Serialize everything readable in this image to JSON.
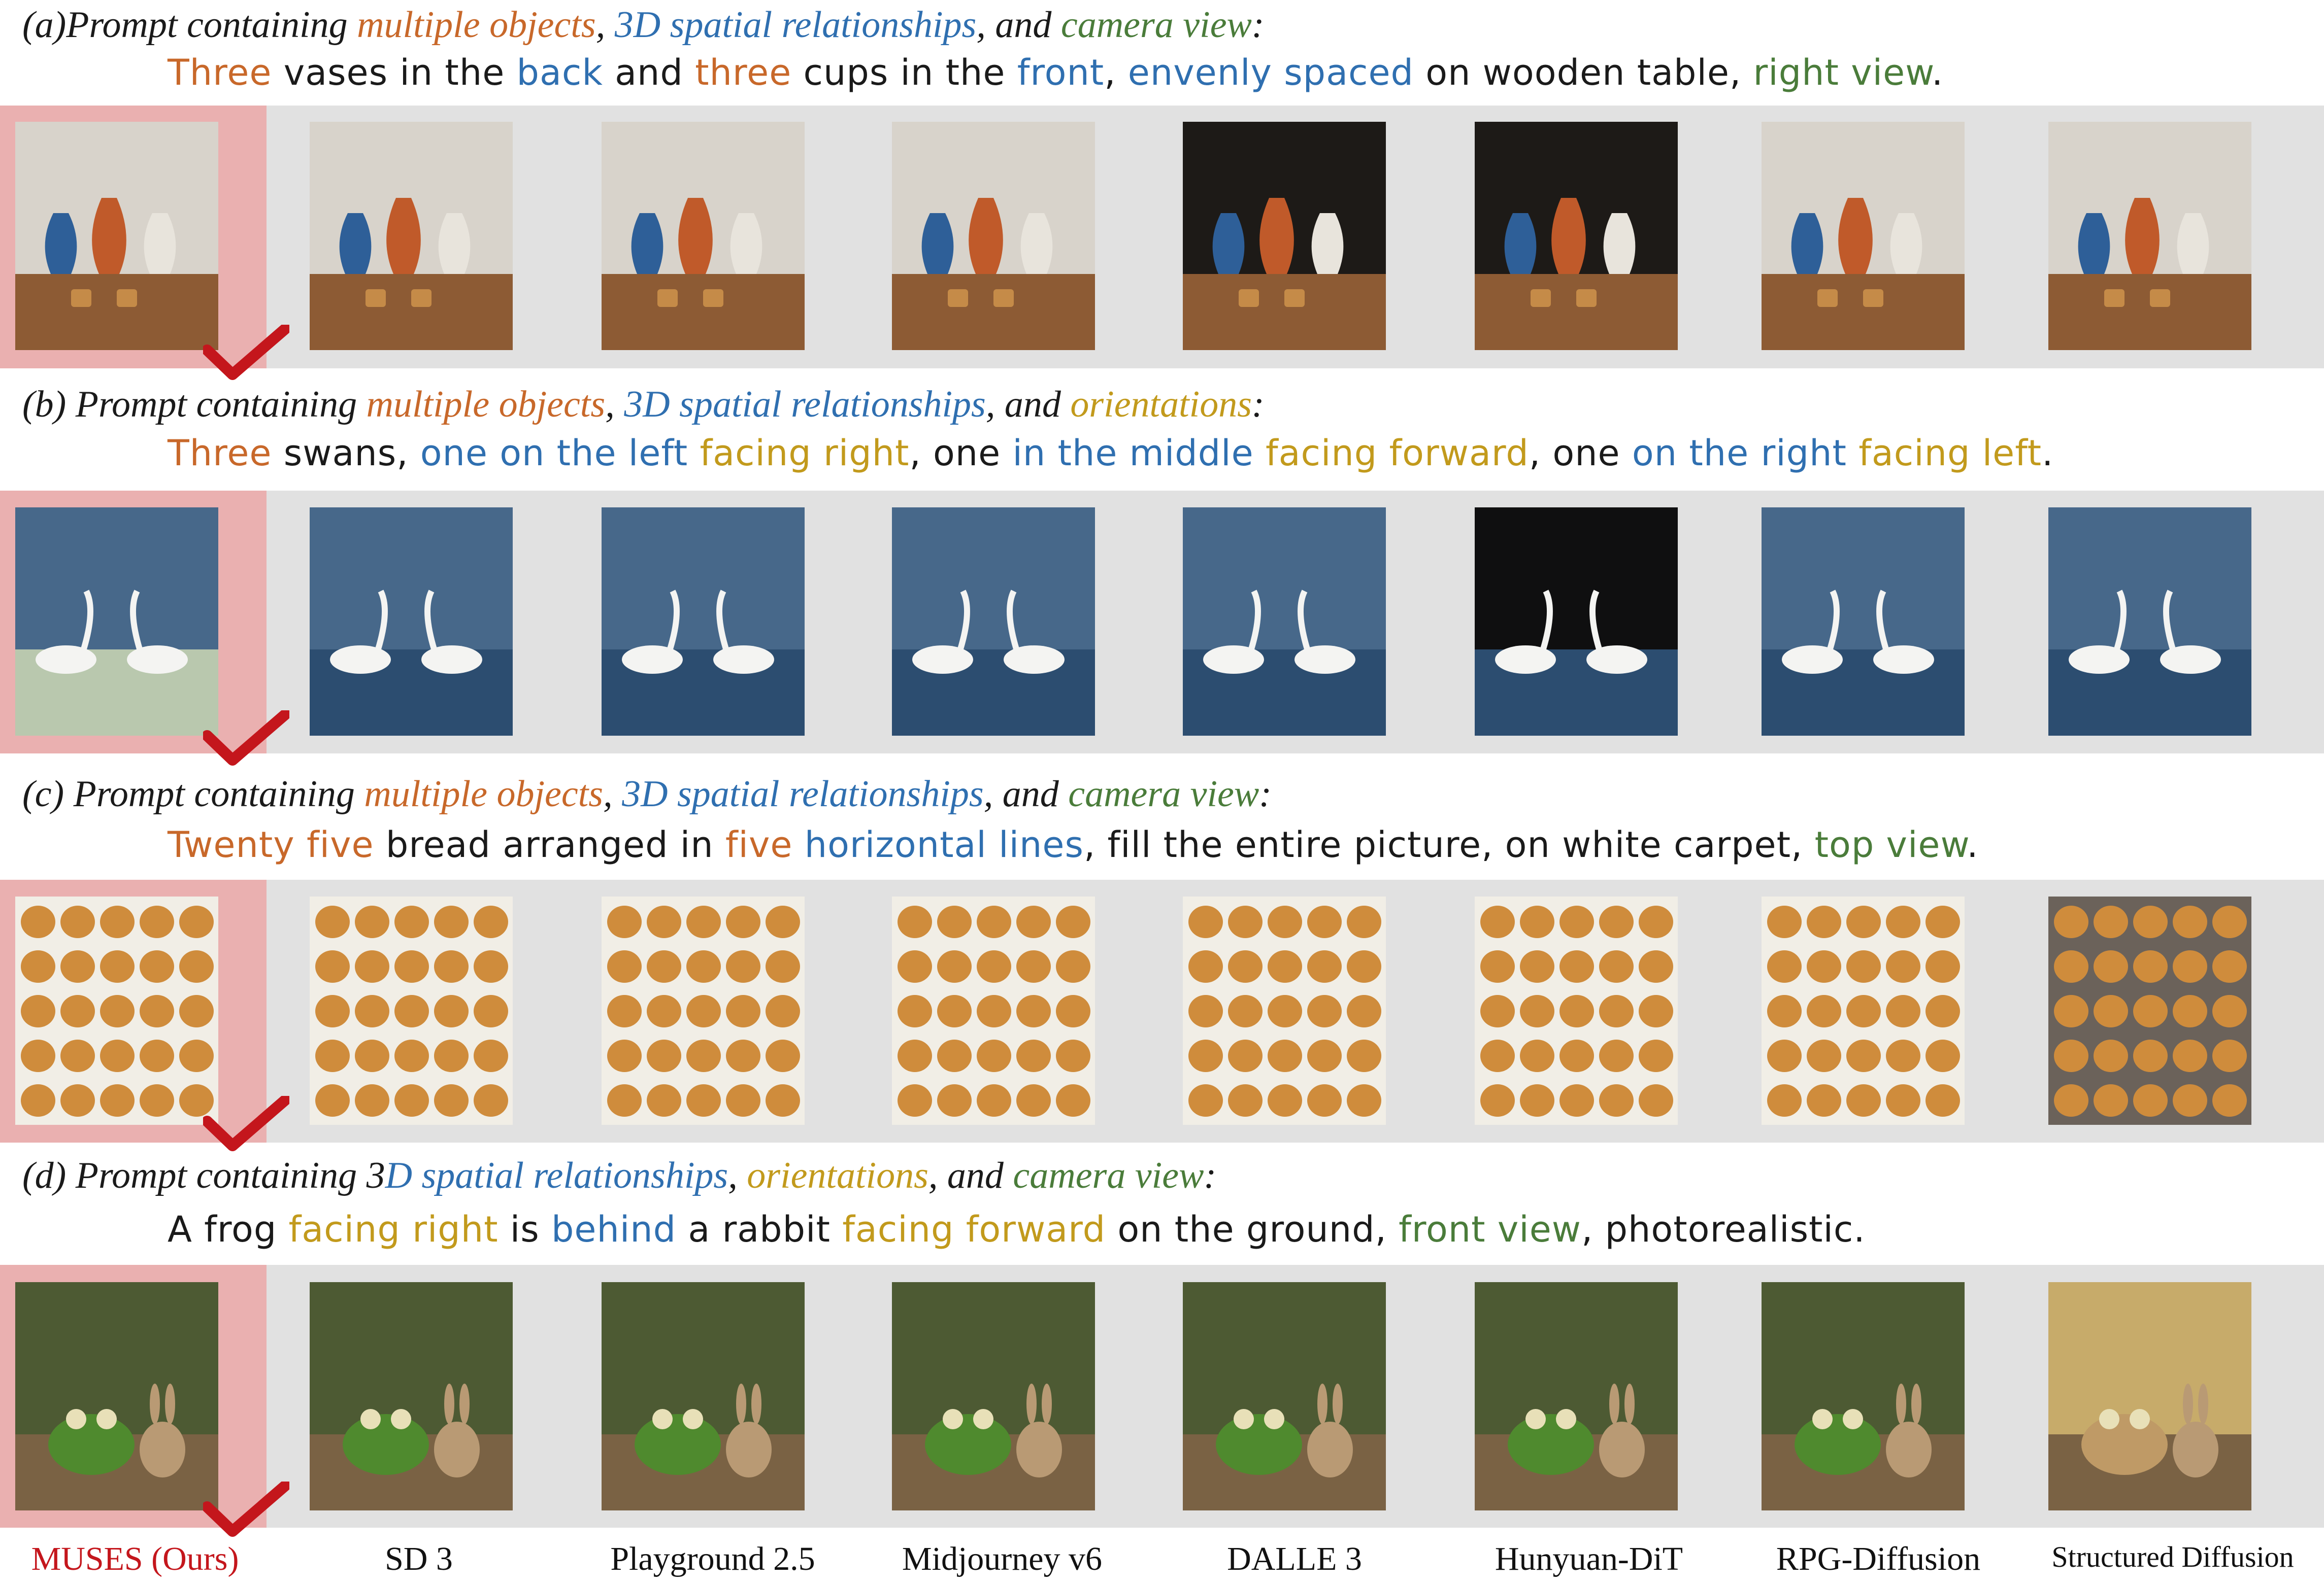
{
  "rows": [
    {
      "id": "a",
      "header": [
        {
          "t": "(a)Prompt containing ",
          "c": ""
        },
        {
          "t": "multiple objects",
          "c": "c-orange"
        },
        {
          "t": ", ",
          "c": ""
        },
        {
          "t": "3D spatial relationships",
          "c": "c-blue"
        },
        {
          "t": ", and ",
          "c": ""
        },
        {
          "t": "camera view",
          "c": "c-green"
        },
        {
          "t": ":",
          "c": ""
        }
      ],
      "prompt": [
        {
          "t": "Three",
          "c": "c-orange"
        },
        {
          "t": " vases in the ",
          "c": ""
        },
        {
          "t": "back",
          "c": "c-blue"
        },
        {
          "t": " and ",
          "c": ""
        },
        {
          "t": "three",
          "c": "c-orange"
        },
        {
          "t": " cups in the ",
          "c": ""
        },
        {
          "t": "front",
          "c": "c-blue"
        },
        {
          "t": ", ",
          "c": ""
        },
        {
          "t": "envenly spaced",
          "c": "c-blue"
        },
        {
          "t": " on wooden table, ",
          "c": ""
        },
        {
          "t": "right view",
          "c": "c-green"
        },
        {
          "t": ".",
          "c": ""
        }
      ]
    },
    {
      "id": "b",
      "header": [
        {
          "t": "(b) Prompt containing ",
          "c": ""
        },
        {
          "t": "multiple objects",
          "c": "c-orange"
        },
        {
          "t": ", ",
          "c": ""
        },
        {
          "t": "3D spatial relationships",
          "c": "c-blue"
        },
        {
          "t": ", and ",
          "c": ""
        },
        {
          "t": "orientations",
          "c": "c-gold"
        },
        {
          "t": ":",
          "c": ""
        }
      ],
      "prompt": [
        {
          "t": "Three",
          "c": "c-orange"
        },
        {
          "t": " swans, ",
          "c": ""
        },
        {
          "t": "one on the left",
          "c": "c-blue"
        },
        {
          "t": " ",
          "c": ""
        },
        {
          "t": "facing right",
          "c": "c-gold"
        },
        {
          "t": ", one ",
          "c": ""
        },
        {
          "t": "in the middle",
          "c": "c-blue"
        },
        {
          "t": " ",
          "c": ""
        },
        {
          "t": "facing forward",
          "c": "c-gold"
        },
        {
          "t": ", one ",
          "c": ""
        },
        {
          "t": "on the right",
          "c": "c-blue"
        },
        {
          "t": " ",
          "c": ""
        },
        {
          "t": "facing left",
          "c": "c-gold"
        },
        {
          "t": ".",
          "c": ""
        }
      ]
    },
    {
      "id": "c",
      "header": [
        {
          "t": "(c) Prompt containing ",
          "c": ""
        },
        {
          "t": "multiple objects",
          "c": "c-orange"
        },
        {
          "t": ", ",
          "c": ""
        },
        {
          "t": "3D spatial relationships",
          "c": "c-blue"
        },
        {
          "t": ", and ",
          "c": ""
        },
        {
          "t": "camera view",
          "c": "c-green"
        },
        {
          "t": ":",
          "c": ""
        }
      ],
      "prompt": [
        {
          "t": "Twenty five",
          "c": "c-orange"
        },
        {
          "t": " bread arranged in ",
          "c": ""
        },
        {
          "t": "five",
          "c": "c-orange"
        },
        {
          "t": " ",
          "c": ""
        },
        {
          "t": "horizontal lines",
          "c": "c-blue"
        },
        {
          "t": ", fill the entire picture, on white carpet, ",
          "c": ""
        },
        {
          "t": "top view",
          "c": "c-green"
        },
        {
          "t": ".",
          "c": ""
        }
      ]
    },
    {
      "id": "d",
      "header": [
        {
          "t": "(d) Prompt containing 3",
          "c": ""
        },
        {
          "t": "D spatial relationships",
          "c": "c-blue"
        },
        {
          "t": ", ",
          "c": ""
        },
        {
          "t": "orientations",
          "c": "c-gold"
        },
        {
          "t": ", and ",
          "c": ""
        },
        {
          "t": "camera view",
          "c": "c-green"
        },
        {
          "t": ":",
          "c": ""
        }
      ],
      "prompt": [
        {
          "t": "A frog ",
          "c": ""
        },
        {
          "t": "facing right",
          "c": "c-gold"
        },
        {
          "t": " is ",
          "c": ""
        },
        {
          "t": "behind",
          "c": "c-blue"
        },
        {
          "t": " a rabbit ",
          "c": ""
        },
        {
          "t": "facing forward",
          "c": "c-gold"
        },
        {
          "t": " on the ground, ",
          "c": ""
        },
        {
          "t": "front view",
          "c": "c-green"
        },
        {
          "t": ", photorealistic.",
          "c": ""
        }
      ]
    }
  ],
  "methods": [
    "MUSES (Ours)",
    "SD 3",
    "Playground 2.5",
    "Midjourney v6",
    "DALLE 3",
    "Hunyuan-DiT",
    "RPG-Diffusion",
    "Structured Diffusion"
  ],
  "colors": {
    "highlight_bg": "#eab0b0",
    "band_bg": "#e1e1e1",
    "check_red": "#c4161c",
    "multiple_objects": "#c8682a",
    "spatial": "#2f6fb0",
    "camera_view": "#4a7c3a",
    "orientations": "#c29a1c"
  }
}
